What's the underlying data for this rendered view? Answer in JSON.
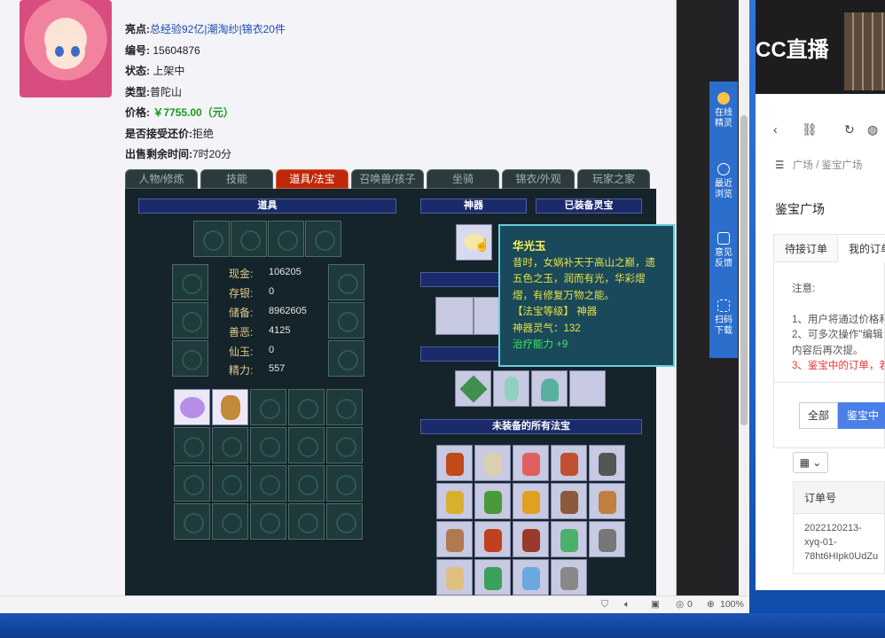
{
  "item": {
    "highlights_label": "亮点:",
    "highlights": "总经验92亿|潮淘纱|锦衣20件",
    "id_label": "编号:",
    "id": "15604876",
    "status_label": "状态:",
    "status": "上架中",
    "type_label": "类型:",
    "type": "普陀山",
    "price_label": "价格:",
    "price": "￥7755.00（元）",
    "counter_label": "是否接受还价:",
    "counter": "拒绝",
    "time_label": "出售剩余时间:",
    "time": "7时20分"
  },
  "tabs": [
    "人物/修炼",
    "技能",
    "道具/法宝",
    "召唤兽/孩子",
    "坐骑",
    "锦衣/外观",
    "玩家之家"
  ],
  "panels": {
    "items_header": "道具",
    "artifact_header": "神器",
    "equipped_header": "已装备灵宝",
    "unequipped_header": "未装备的所有法宝"
  },
  "stats": [
    {
      "label": "现金:",
      "value": "106205"
    },
    {
      "label": "存银:",
      "value": "0"
    },
    {
      "label": "储备:",
      "value": "8962605"
    },
    {
      "label": "善恶:",
      "value": "4125"
    },
    {
      "label": "仙玉:",
      "value": "0"
    },
    {
      "label": "精力:",
      "value": "557"
    }
  ],
  "tooltip": {
    "title": "华光玉",
    "line1": "昔时，女娲补天于高山之巅，遗",
    "line2": "五色之玉，润而有光，华彩熠",
    "line3": "熠，有修复万物之能。",
    "line4": "【法宝等级】 神器",
    "line5": "神器灵气：132",
    "line6": "治疗能力 +9"
  },
  "sidebar": [
    {
      "label": "在线\n精灵"
    },
    {
      "label": "最近\n浏览"
    },
    {
      "label": "意见\n反馈"
    },
    {
      "label": "扫码\n下载"
    }
  ],
  "statusbar": {
    "count": "0",
    "zoom": "100%"
  },
  "right": {
    "brand": "CC直播",
    "crumb1": "广场",
    "crumb2": "鉴宝广场",
    "title": "鉴宝广场",
    "tab1": "待接订单",
    "tab2": "我的订单",
    "notice_title": "注意:",
    "n1": "1、用户将通过价格和",
    "n2": "2、可多次操作\"编辑",
    "n3": "内容后再次提。",
    "n4": "3、鉴宝中的订单，若",
    "btn_all": "全部",
    "btn_jb": "鉴宝中",
    "col_order": "订单号",
    "order_id_1": "2022120213-",
    "order_id_2": "xyq-01-",
    "order_id_3": "78ht6HIpk0UdZu"
  },
  "colors": {
    "accent": "#2b6ecb",
    "active_tab": "#c0280a",
    "price": "#1a9a1a"
  }
}
